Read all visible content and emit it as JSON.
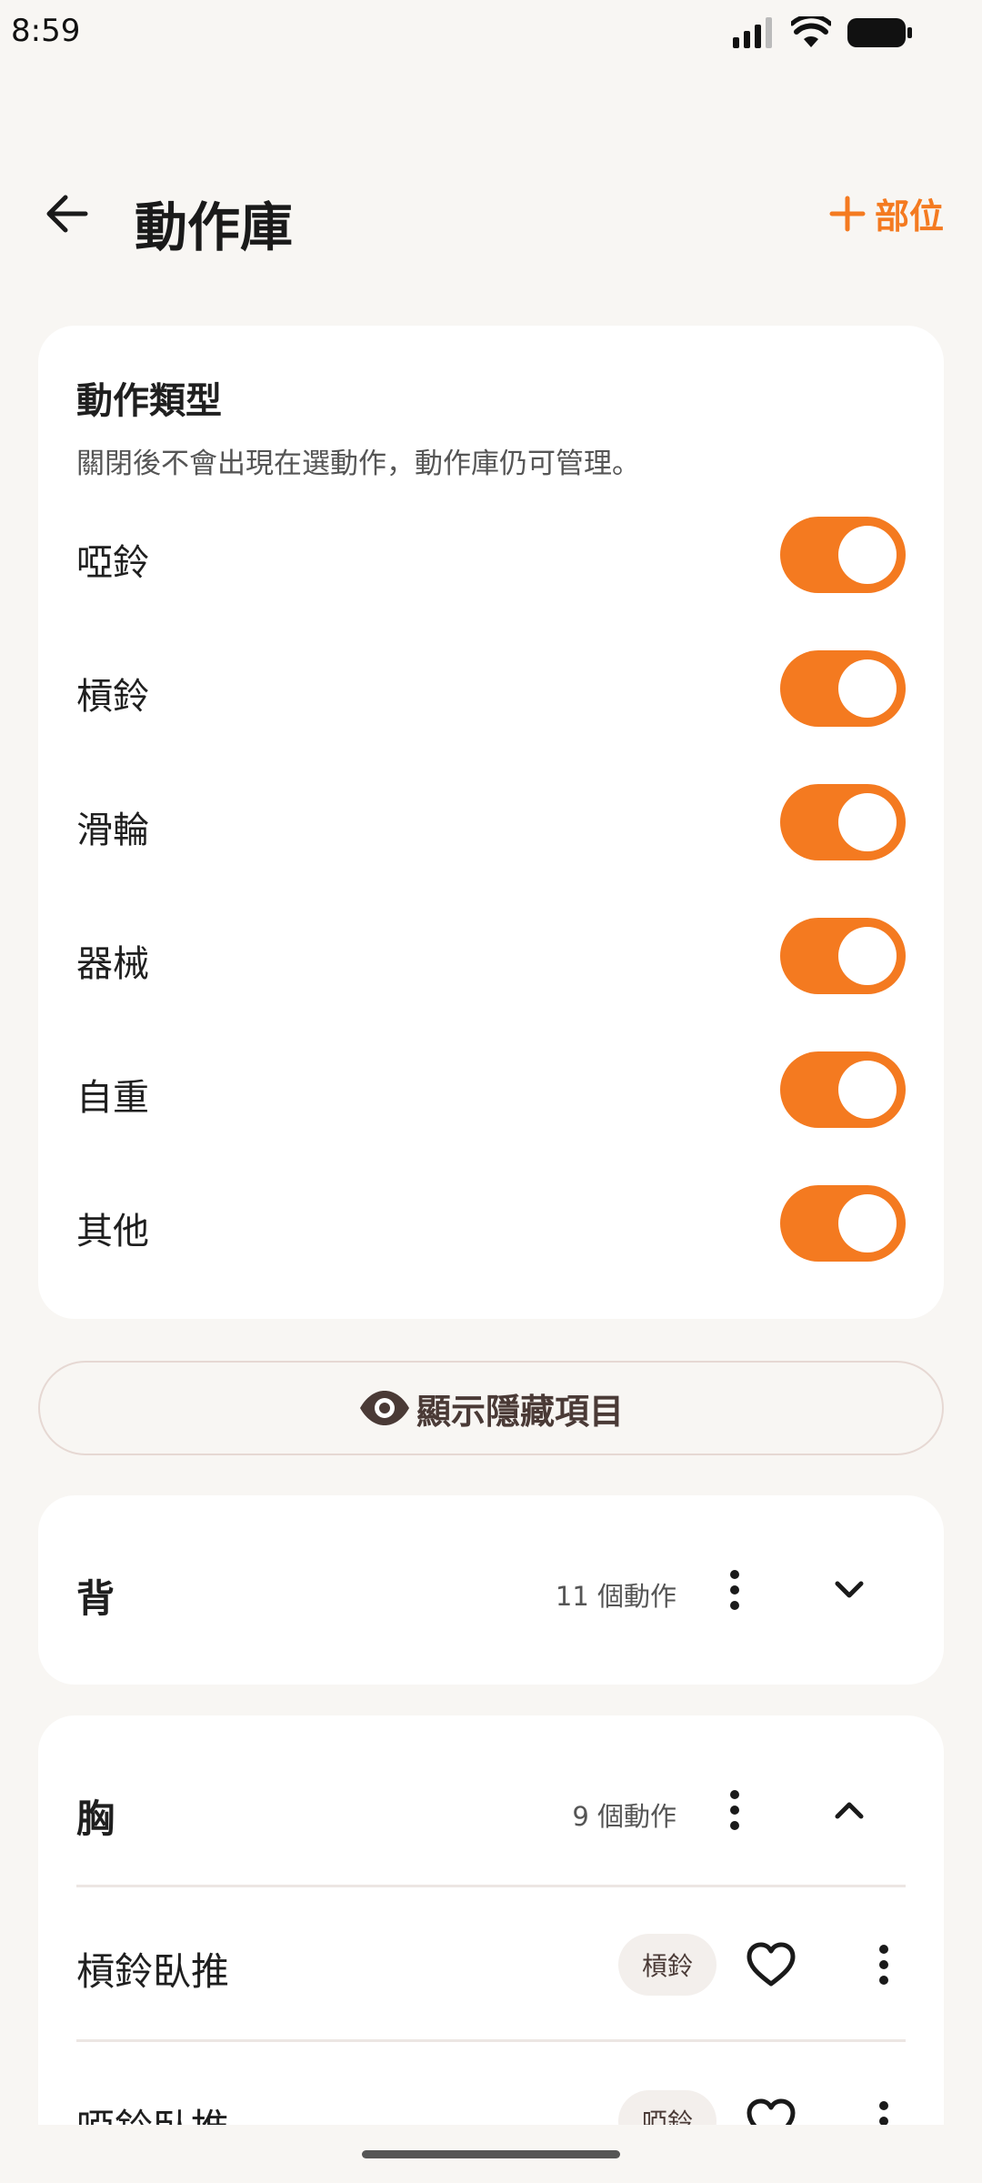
{
  "status_bar": {
    "time": "8:59"
  },
  "header": {
    "title": "動作庫",
    "add_label": "部位"
  },
  "types_card": {
    "title": "動作類型",
    "description": "關閉後不會出現在選動作，動作庫仍可管理。",
    "types": [
      {
        "label": "啞鈴",
        "enabled": true
      },
      {
        "label": "槓鈴",
        "enabled": true
      },
      {
        "label": "滑輪",
        "enabled": true
      },
      {
        "label": "器械",
        "enabled": true
      },
      {
        "label": "自重",
        "enabled": true
      },
      {
        "label": "其他",
        "enabled": true
      }
    ]
  },
  "show_hidden_label": "顯示隱藏項目",
  "groups": [
    {
      "name": "背",
      "count_label": "11 個動作",
      "expanded": false
    },
    {
      "name": "胸",
      "count_label": "9 個動作",
      "expanded": true,
      "exercises": [
        {
          "name": "槓鈴臥推",
          "badge": "槓鈴"
        },
        {
          "name": "啞鈴臥推",
          "badge": "啞鈴"
        }
      ]
    }
  ],
  "colors": {
    "accent": "#f47a20",
    "background": "#f8f6f3",
    "card": "#ffffff"
  }
}
